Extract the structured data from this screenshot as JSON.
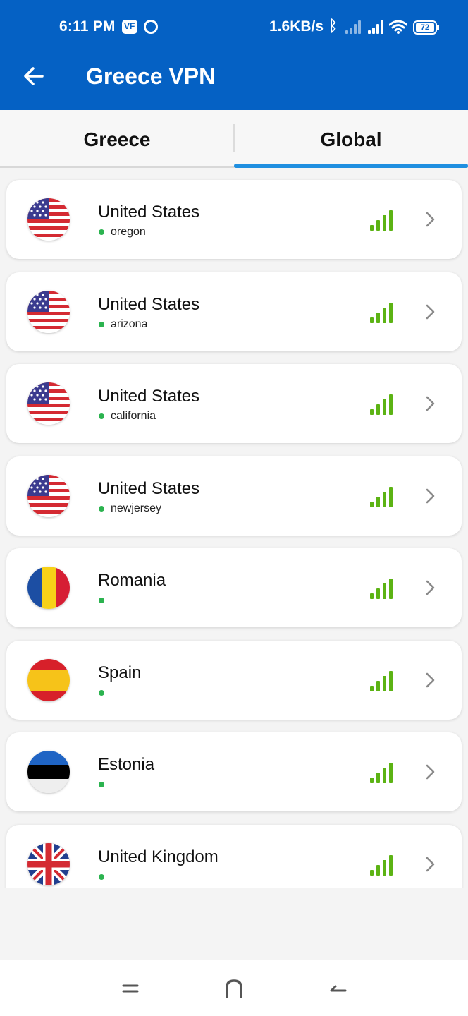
{
  "status_bar": {
    "time": "6:11 PM",
    "vpn_badge": "VF",
    "speed": "1.6KB/s",
    "battery": "72"
  },
  "header": {
    "title": "Greece VPN"
  },
  "tabs": [
    {
      "label": "Greece",
      "active": false
    },
    {
      "label": "Global",
      "active": true
    }
  ],
  "servers": [
    {
      "country": "United States",
      "region": "oregon",
      "flag": "us-flag-icon",
      "signal_bars": 4
    },
    {
      "country": "United States",
      "region": "arizona",
      "flag": "us-flag-icon",
      "signal_bars": 4
    },
    {
      "country": "United States",
      "region": "california",
      "flag": "us-flag-icon",
      "signal_bars": 4
    },
    {
      "country": "United States",
      "region": "newjersey",
      "flag": "us-flag-icon",
      "signal_bars": 4
    },
    {
      "country": "Romania",
      "region": "",
      "flag": "romania-flag-icon",
      "signal_bars": 4
    },
    {
      "country": "Spain",
      "region": "",
      "flag": "spain-flag-icon",
      "signal_bars": 4
    },
    {
      "country": "Estonia",
      "region": "",
      "flag": "estonia-flag-icon",
      "signal_bars": 4
    },
    {
      "country": "United Kingdom",
      "region": "",
      "flag": "uk-flag-icon",
      "signal_bars": 4
    }
  ],
  "colors": {
    "app_bar": "#0561c4",
    "tab_indicator": "#1f8fe0",
    "signal": "#5cb314",
    "online_dot": "#2bb34f"
  },
  "nav_bar": {
    "icons": [
      "menu-icon",
      "home-icon",
      "back-icon"
    ]
  }
}
